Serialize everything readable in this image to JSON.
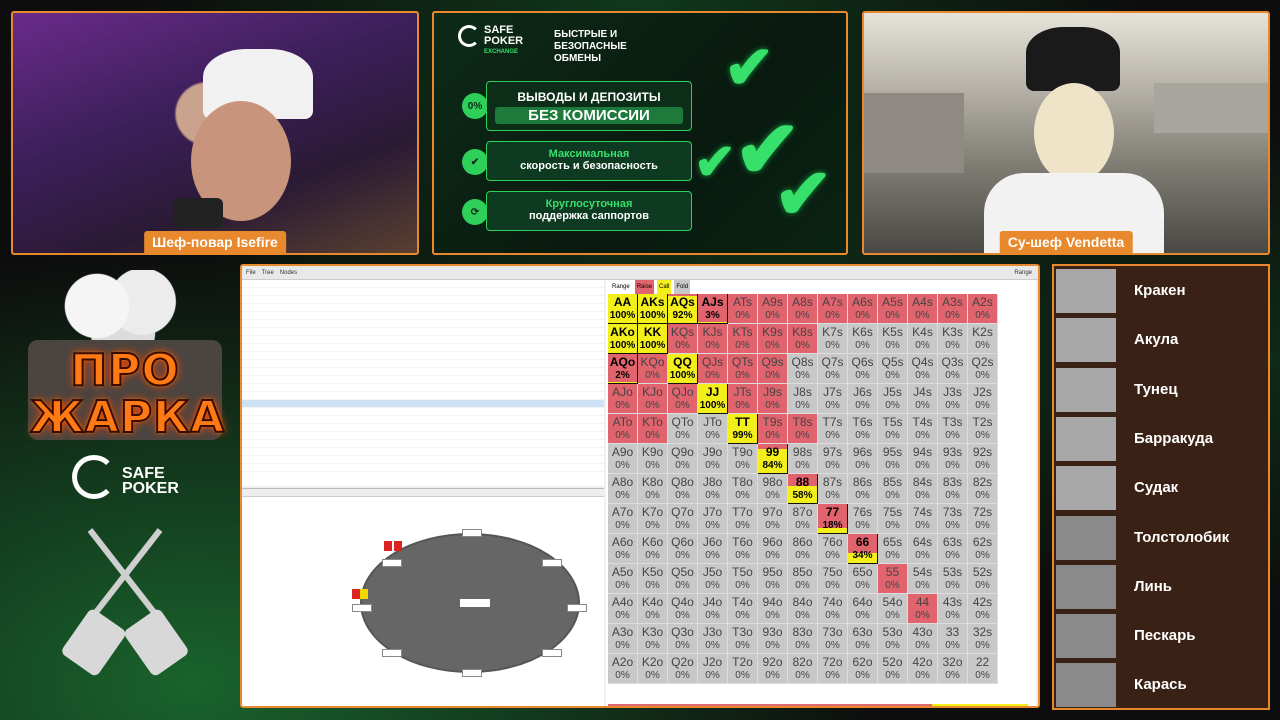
{
  "colors": {
    "frame": "#e8892e",
    "raise": "#e0636d",
    "call": "#f2ef1a",
    "fold": "#c8c8c8"
  },
  "cams": {
    "left_name": "Шеф-повар Isefire",
    "right_name": "Су-шеф Vendetta"
  },
  "ad": {
    "brand_top": "SAFE",
    "brand_bottom": "POKER",
    "brand_sub": "EXCHANGE",
    "tagline": "БЫСТРЫЕ И БЕЗОПАСНЫЕ ОБМЕНЫ",
    "box1_line1": "ВЫВОДЫ И ДЕПОЗИТЫ",
    "box1_line2": "БЕЗ КОМИССИИ",
    "box1_icon": "0%",
    "box2_line1": "Максимальная",
    "box2_line2": "скорость и безопасность",
    "box3_line1": "Круглосуточная",
    "box3_line2": "поддержка саппортов"
  },
  "logo": {
    "line1": "ПРО",
    "line2": "ЖАРКА",
    "sponsor_top": "SAFE",
    "sponsor_bottom": "POKER"
  },
  "app": {
    "toolbar": [
      "File",
      "Tree",
      "Nodes",
      "Range"
    ],
    "tree_rows": [
      "",
      "",
      "",
      "",
      "",
      "",
      "",
      "",
      "",
      "",
      "",
      "",
      "",
      "",
      "",
      "",
      "",
      "",
      "",
      "",
      "",
      "",
      "",
      ""
    ],
    "legend": [
      "Range",
      "Raise",
      "Call",
      "Fold"
    ]
  },
  "grid": [
    {
      "h": "AA",
      "p": "100%",
      "r": 0,
      "c": 100,
      "hl": true
    },
    {
      "h": "AKs",
      "p": "100%",
      "r": 0,
      "c": 100,
      "hl": true
    },
    {
      "h": "AQs",
      "p": "92%",
      "r": 8,
      "c": 92,
      "hl": true
    },
    {
      "h": "AJs",
      "p": "3%",
      "r": 97,
      "c": 3,
      "hl": true
    },
    {
      "h": "ATs",
      "p": "0%",
      "r": 100,
      "c": 0
    },
    {
      "h": "A9s",
      "p": "0%",
      "r": 100,
      "c": 0
    },
    {
      "h": "A8s",
      "p": "0%",
      "r": 100,
      "c": 0
    },
    {
      "h": "A7s",
      "p": "0%",
      "r": 100,
      "c": 0
    },
    {
      "h": "A6s",
      "p": "0%",
      "r": 100,
      "c": 0
    },
    {
      "h": "A5s",
      "p": "0%",
      "r": 100,
      "c": 0
    },
    {
      "h": "A4s",
      "p": "0%",
      "r": 100,
      "c": 0
    },
    {
      "h": "A3s",
      "p": "0%",
      "r": 100,
      "c": 0
    },
    {
      "h": "A2s",
      "p": "0%",
      "r": 100,
      "c": 0
    },
    {
      "h": "AKo",
      "p": "100%",
      "r": 0,
      "c": 100,
      "hl": true
    },
    {
      "h": "KK",
      "p": "100%",
      "r": 0,
      "c": 100,
      "hl": true
    },
    {
      "h": "KQs",
      "p": "0%",
      "r": 100,
      "c": 0
    },
    {
      "h": "KJs",
      "p": "0%",
      "r": 100,
      "c": 0
    },
    {
      "h": "KTs",
      "p": "0%",
      "r": 100,
      "c": 0
    },
    {
      "h": "K9s",
      "p": "0%",
      "r": 100,
      "c": 0
    },
    {
      "h": "K8s",
      "p": "0%",
      "r": 100,
      "c": 0
    },
    {
      "h": "K7s",
      "p": "0%",
      "r": 0,
      "c": 0
    },
    {
      "h": "K6s",
      "p": "0%",
      "r": 0,
      "c": 0
    },
    {
      "h": "K5s",
      "p": "0%",
      "r": 0,
      "c": 0
    },
    {
      "h": "K4s",
      "p": "0%",
      "r": 0,
      "c": 0
    },
    {
      "h": "K3s",
      "p": "0%",
      "r": 0,
      "c": 0
    },
    {
      "h": "K2s",
      "p": "0%",
      "r": 0,
      "c": 0
    },
    {
      "h": "AQo",
      "p": "2%",
      "r": 98,
      "c": 2,
      "hl": true
    },
    {
      "h": "KQo",
      "p": "0%",
      "r": 100,
      "c": 0
    },
    {
      "h": "QQ",
      "p": "100%",
      "r": 0,
      "c": 100,
      "hl": true
    },
    {
      "h": "QJs",
      "p": "0%",
      "r": 100,
      "c": 0
    },
    {
      "h": "QTs",
      "p": "0%",
      "r": 100,
      "c": 0
    },
    {
      "h": "Q9s",
      "p": "0%",
      "r": 100,
      "c": 0
    },
    {
      "h": "Q8s",
      "p": "0%",
      "r": 0,
      "c": 0
    },
    {
      "h": "Q7s",
      "p": "0%",
      "r": 0,
      "c": 0
    },
    {
      "h": "Q6s",
      "p": "0%",
      "r": 0,
      "c": 0
    },
    {
      "h": "Q5s",
      "p": "0%",
      "r": 0,
      "c": 0
    },
    {
      "h": "Q4s",
      "p": "0%",
      "r": 0,
      "c": 0
    },
    {
      "h": "Q3s",
      "p": "0%",
      "r": 0,
      "c": 0
    },
    {
      "h": "Q2s",
      "p": "0%",
      "r": 0,
      "c": 0
    },
    {
      "h": "AJo",
      "p": "0%",
      "r": 100,
      "c": 0
    },
    {
      "h": "KJo",
      "p": "0%",
      "r": 100,
      "c": 0
    },
    {
      "h": "QJo",
      "p": "0%",
      "r": 100,
      "c": 0
    },
    {
      "h": "JJ",
      "p": "100%",
      "r": 0,
      "c": 100,
      "hl": true
    },
    {
      "h": "JTs",
      "p": "0%",
      "r": 100,
      "c": 0
    },
    {
      "h": "J9s",
      "p": "0%",
      "r": 100,
      "c": 0
    },
    {
      "h": "J8s",
      "p": "0%",
      "r": 0,
      "c": 0
    },
    {
      "h": "J7s",
      "p": "0%",
      "r": 0,
      "c": 0
    },
    {
      "h": "J6s",
      "p": "0%",
      "r": 0,
      "c": 0
    },
    {
      "h": "J5s",
      "p": "0%",
      "r": 0,
      "c": 0
    },
    {
      "h": "J4s",
      "p": "0%",
      "r": 0,
      "c": 0
    },
    {
      "h": "J3s",
      "p": "0%",
      "r": 0,
      "c": 0
    },
    {
      "h": "J2s",
      "p": "0%",
      "r": 0,
      "c": 0
    },
    {
      "h": "ATo",
      "p": "0%",
      "r": 100,
      "c": 0
    },
    {
      "h": "KTo",
      "p": "0%",
      "r": 100,
      "c": 0
    },
    {
      "h": "QTo",
      "p": "0%",
      "r": 0,
      "c": 0
    },
    {
      "h": "JTo",
      "p": "0%",
      "r": 0,
      "c": 0
    },
    {
      "h": "TT",
      "p": "99%",
      "r": 1,
      "c": 99,
      "hl": true
    },
    {
      "h": "T9s",
      "p": "0%",
      "r": 100,
      "c": 0
    },
    {
      "h": "T8s",
      "p": "0%",
      "r": 100,
      "c": 0
    },
    {
      "h": "T7s",
      "p": "0%",
      "r": 0,
      "c": 0
    },
    {
      "h": "T6s",
      "p": "0%",
      "r": 0,
      "c": 0
    },
    {
      "h": "T5s",
      "p": "0%",
      "r": 0,
      "c": 0
    },
    {
      "h": "T4s",
      "p": "0%",
      "r": 0,
      "c": 0
    },
    {
      "h": "T3s",
      "p": "0%",
      "r": 0,
      "c": 0
    },
    {
      "h": "T2s",
      "p": "0%",
      "r": 0,
      "c": 0
    },
    {
      "h": "A9o",
      "p": "0%",
      "r": 0,
      "c": 0
    },
    {
      "h": "K9o",
      "p": "0%",
      "r": 0,
      "c": 0
    },
    {
      "h": "Q9o",
      "p": "0%",
      "r": 0,
      "c": 0
    },
    {
      "h": "J9o",
      "p": "0%",
      "r": 0,
      "c": 0
    },
    {
      "h": "T9o",
      "p": "0%",
      "r": 0,
      "c": 0
    },
    {
      "h": "99",
      "p": "84%",
      "r": 16,
      "c": 84,
      "hl": true
    },
    {
      "h": "98s",
      "p": "0%",
      "r": 0,
      "c": 0
    },
    {
      "h": "97s",
      "p": "0%",
      "r": 0,
      "c": 0
    },
    {
      "h": "96s",
      "p": "0%",
      "r": 0,
      "c": 0
    },
    {
      "h": "95s",
      "p": "0%",
      "r": 0,
      "c": 0
    },
    {
      "h": "94s",
      "p": "0%",
      "r": 0,
      "c": 0
    },
    {
      "h": "93s",
      "p": "0%",
      "r": 0,
      "c": 0
    },
    {
      "h": "92s",
      "p": "0%",
      "r": 0,
      "c": 0
    },
    {
      "h": "A8o",
      "p": "0%",
      "r": 0,
      "c": 0
    },
    {
      "h": "K8o",
      "p": "0%",
      "r": 0,
      "c": 0
    },
    {
      "h": "Q8o",
      "p": "0%",
      "r": 0,
      "c": 0
    },
    {
      "h": "J8o",
      "p": "0%",
      "r": 0,
      "c": 0
    },
    {
      "h": "T8o",
      "p": "0%",
      "r": 0,
      "c": 0
    },
    {
      "h": "98o",
      "p": "0%",
      "r": 0,
      "c": 0
    },
    {
      "h": "88",
      "p": "58%",
      "r": 42,
      "c": 58,
      "hl": true
    },
    {
      "h": "87s",
      "p": "0%",
      "r": 0,
      "c": 0
    },
    {
      "h": "86s",
      "p": "0%",
      "r": 0,
      "c": 0
    },
    {
      "h": "85s",
      "p": "0%",
      "r": 0,
      "c": 0
    },
    {
      "h": "84s",
      "p": "0%",
      "r": 0,
      "c": 0
    },
    {
      "h": "83s",
      "p": "0%",
      "r": 0,
      "c": 0
    },
    {
      "h": "82s",
      "p": "0%",
      "r": 0,
      "c": 0
    },
    {
      "h": "A7o",
      "p": "0%",
      "r": 0,
      "c": 0
    },
    {
      "h": "K7o",
      "p": "0%",
      "r": 0,
      "c": 0
    },
    {
      "h": "Q7o",
      "p": "0%",
      "r": 0,
      "c": 0
    },
    {
      "h": "J7o",
      "p": "0%",
      "r": 0,
      "c": 0
    },
    {
      "h": "T7o",
      "p": "0%",
      "r": 0,
      "c": 0
    },
    {
      "h": "97o",
      "p": "0%",
      "r": 0,
      "c": 0
    },
    {
      "h": "87o",
      "p": "0%",
      "r": 0,
      "c": 0
    },
    {
      "h": "77",
      "p": "18%",
      "r": 82,
      "c": 18,
      "hl": true
    },
    {
      "h": "76s",
      "p": "0%",
      "r": 0,
      "c": 0
    },
    {
      "h": "75s",
      "p": "0%",
      "r": 0,
      "c": 0
    },
    {
      "h": "74s",
      "p": "0%",
      "r": 0,
      "c": 0
    },
    {
      "h": "73s",
      "p": "0%",
      "r": 0,
      "c": 0
    },
    {
      "h": "72s",
      "p": "0%",
      "r": 0,
      "c": 0
    },
    {
      "h": "A6o",
      "p": "0%",
      "r": 0,
      "c": 0
    },
    {
      "h": "K6o",
      "p": "0%",
      "r": 0,
      "c": 0
    },
    {
      "h": "Q6o",
      "p": "0%",
      "r": 0,
      "c": 0
    },
    {
      "h": "J6o",
      "p": "0%",
      "r": 0,
      "c": 0
    },
    {
      "h": "T6o",
      "p": "0%",
      "r": 0,
      "c": 0
    },
    {
      "h": "96o",
      "p": "0%",
      "r": 0,
      "c": 0
    },
    {
      "h": "86o",
      "p": "0%",
      "r": 0,
      "c": 0
    },
    {
      "h": "76o",
      "p": "0%",
      "r": 0,
      "c": 0
    },
    {
      "h": "66",
      "p": "34%",
      "r": 66,
      "c": 34,
      "hl": true
    },
    {
      "h": "65s",
      "p": "0%",
      "r": 0,
      "c": 0
    },
    {
      "h": "64s",
      "p": "0%",
      "r": 0,
      "c": 0
    },
    {
      "h": "63s",
      "p": "0%",
      "r": 0,
      "c": 0
    },
    {
      "h": "62s",
      "p": "0%",
      "r": 0,
      "c": 0
    },
    {
      "h": "A5o",
      "p": "0%",
      "r": 0,
      "c": 0
    },
    {
      "h": "K5o",
      "p": "0%",
      "r": 0,
      "c": 0
    },
    {
      "h": "Q5o",
      "p": "0%",
      "r": 0,
      "c": 0
    },
    {
      "h": "J5o",
      "p": "0%",
      "r": 0,
      "c": 0
    },
    {
      "h": "T5o",
      "p": "0%",
      "r": 0,
      "c": 0
    },
    {
      "h": "95o",
      "p": "0%",
      "r": 0,
      "c": 0
    },
    {
      "h": "85o",
      "p": "0%",
      "r": 0,
      "c": 0
    },
    {
      "h": "75o",
      "p": "0%",
      "r": 0,
      "c": 0
    },
    {
      "h": "65o",
      "p": "0%",
      "r": 0,
      "c": 0
    },
    {
      "h": "55",
      "p": "0%",
      "r": 100,
      "c": 0
    },
    {
      "h": "54s",
      "p": "0%",
      "r": 0,
      "c": 0
    },
    {
      "h": "53s",
      "p": "0%",
      "r": 0,
      "c": 0
    },
    {
      "h": "52s",
      "p": "0%",
      "r": 0,
      "c": 0
    },
    {
      "h": "A4o",
      "p": "0%",
      "r": 0,
      "c": 0
    },
    {
      "h": "K4o",
      "p": "0%",
      "r": 0,
      "c": 0
    },
    {
      "h": "Q4o",
      "p": "0%",
      "r": 0,
      "c": 0
    },
    {
      "h": "J4o",
      "p": "0%",
      "r": 0,
      "c": 0
    },
    {
      "h": "T4o",
      "p": "0%",
      "r": 0,
      "c": 0
    },
    {
      "h": "94o",
      "p": "0%",
      "r": 0,
      "c": 0
    },
    {
      "h": "84o",
      "p": "0%",
      "r": 0,
      "c": 0
    },
    {
      "h": "74o",
      "p": "0%",
      "r": 0,
      "c": 0
    },
    {
      "h": "64o",
      "p": "0%",
      "r": 0,
      "c": 0
    },
    {
      "h": "54o",
      "p": "0%",
      "r": 0,
      "c": 0
    },
    {
      "h": "44",
      "p": "0%",
      "r": 100,
      "c": 0
    },
    {
      "h": "43s",
      "p": "0%",
      "r": 0,
      "c": 0
    },
    {
      "h": "42s",
      "p": "0%",
      "r": 0,
      "c": 0
    },
    {
      "h": "A3o",
      "p": "0%",
      "r": 0,
      "c": 0
    },
    {
      "h": "K3o",
      "p": "0%",
      "r": 0,
      "c": 0
    },
    {
      "h": "Q3o",
      "p": "0%",
      "r": 0,
      "c": 0
    },
    {
      "h": "J3o",
      "p": "0%",
      "r": 0,
      "c": 0
    },
    {
      "h": "T3o",
      "p": "0%",
      "r": 0,
      "c": 0
    },
    {
      "h": "93o",
      "p": "0%",
      "r": 0,
      "c": 0
    },
    {
      "h": "83o",
      "p": "0%",
      "r": 0,
      "c": 0
    },
    {
      "h": "73o",
      "p": "0%",
      "r": 0,
      "c": 0
    },
    {
      "h": "63o",
      "p": "0%",
      "r": 0,
      "c": 0
    },
    {
      "h": "53o",
      "p": "0%",
      "r": 0,
      "c": 0
    },
    {
      "h": "43o",
      "p": "0%",
      "r": 0,
      "c": 0
    },
    {
      "h": "33",
      "p": "0%",
      "r": 0,
      "c": 0
    },
    {
      "h": "32s",
      "p": "0%",
      "r": 0,
      "c": 0
    },
    {
      "h": "A2o",
      "p": "0%",
      "r": 0,
      "c": 0
    },
    {
      "h": "K2o",
      "p": "0%",
      "r": 0,
      "c": 0
    },
    {
      "h": "Q2o",
      "p": "0%",
      "r": 0,
      "c": 0
    },
    {
      "h": "J2o",
      "p": "0%",
      "r": 0,
      "c": 0
    },
    {
      "h": "T2o",
      "p": "0%",
      "r": 0,
      "c": 0
    },
    {
      "h": "92o",
      "p": "0%",
      "r": 0,
      "c": 0
    },
    {
      "h": "82o",
      "p": "0%",
      "r": 0,
      "c": 0
    },
    {
      "h": "72o",
      "p": "0%",
      "r": 0,
      "c": 0
    },
    {
      "h": "62o",
      "p": "0%",
      "r": 0,
      "c": 0
    },
    {
      "h": "52o",
      "p": "0%",
      "r": 0,
      "c": 0
    },
    {
      "h": "42o",
      "p": "0%",
      "r": 0,
      "c": 0
    },
    {
      "h": "32o",
      "p": "0%",
      "r": 0,
      "c": 0
    },
    {
      "h": "22",
      "p": "0%",
      "r": 0,
      "c": 0
    }
  ],
  "leaderboard": [
    "Кракен",
    "Акула",
    "Тунец",
    "Барракуда",
    "Судак",
    "Толстолобик",
    "Линь",
    "Пескарь",
    "Карась"
  ]
}
